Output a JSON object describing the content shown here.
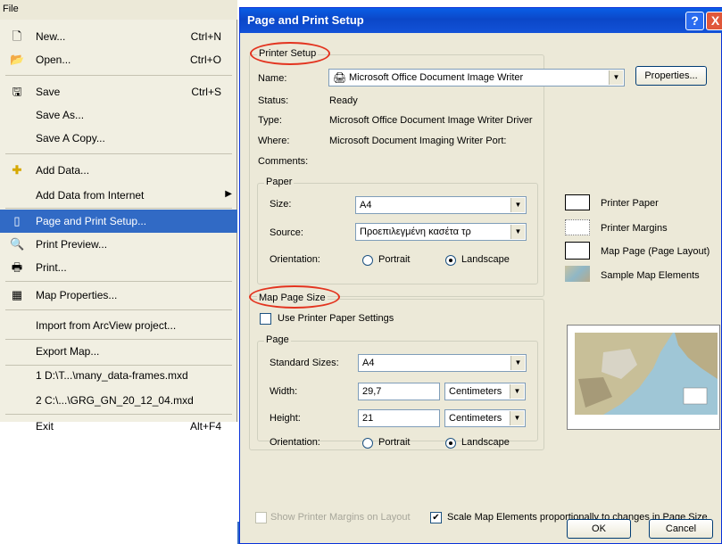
{
  "menu": {
    "bar_label": "File",
    "items": [
      {
        "icon": "new-icon",
        "label": "New...",
        "shortcut": "Ctrl+N"
      },
      {
        "icon": "open-icon",
        "label": "Open...",
        "shortcut": "Ctrl+O"
      },
      {
        "icon": "save-icon",
        "label": "Save",
        "shortcut": "Ctrl+S"
      },
      {
        "icon": "",
        "label": "Save As...",
        "shortcut": ""
      },
      {
        "icon": "",
        "label": "Save A Copy...",
        "shortcut": ""
      },
      {
        "icon": "add-data-icon",
        "label": "Add Data...",
        "shortcut": ""
      },
      {
        "icon": "",
        "label": "Add Data from Internet",
        "shortcut": ""
      },
      {
        "icon": "page-setup-icon",
        "label": "Page and Print Setup...",
        "shortcut": ""
      },
      {
        "icon": "print-preview-icon",
        "label": "Print Preview...",
        "shortcut": ""
      },
      {
        "icon": "print-icon",
        "label": "Print...",
        "shortcut": ""
      },
      {
        "icon": "map-properties-icon",
        "label": "Map Properties...",
        "shortcut": ""
      },
      {
        "icon": "",
        "label": "Import from ArcView project...",
        "shortcut": ""
      },
      {
        "icon": "",
        "label": "Export Map...",
        "shortcut": ""
      },
      {
        "icon": "",
        "label": "1 D:\\T...\\many_data-frames.mxd",
        "shortcut": ""
      },
      {
        "icon": "",
        "label": "2 C:\\...\\GRG_GN_20_12_04.mxd",
        "shortcut": ""
      },
      {
        "icon": "",
        "label": "Exit",
        "shortcut": "Alt+F4"
      }
    ]
  },
  "dialog": {
    "title": "Page and Print Setup",
    "help_glyph": "?",
    "close_glyph": "X",
    "printer_setup": {
      "group_title": "Printer Setup",
      "name_label": "Name:",
      "name_value": "Microsoft Office Document Image Writer",
      "properties_button": "Properties...",
      "status_label": "Status:",
      "status_value": "Ready",
      "type_label": "Type:",
      "type_value": "Microsoft Office Document Image Writer Driver",
      "where_label": "Where:",
      "where_value": "Microsoft Document Imaging Writer Port:",
      "comments_label": "Comments:",
      "comments_value": "",
      "paper": {
        "group_title": "Paper",
        "size_label": "Size:",
        "size_value": "A4",
        "source_label": "Source:",
        "source_value": "Προεπιλεγμένη κασέτα τρ",
        "orientation_label": "Orientation:",
        "portrait_label": "Portrait",
        "landscape_label": "Landscape",
        "selected": "Landscape"
      }
    },
    "legend": {
      "printer_paper": "Printer Paper",
      "printer_margins": "Printer Margins",
      "map_page": "Map Page (Page Layout)",
      "sample_elements": "Sample Map Elements"
    },
    "map_page_size": {
      "group_title": "Map Page Size",
      "use_printer_paper": "Use Printer Paper Settings",
      "use_printer_paper_checked": false,
      "page_group_title": "Page",
      "standard_sizes_label": "Standard Sizes:",
      "standard_sizes_value": "A4",
      "width_label": "Width:",
      "width_value": "29,7",
      "width_unit": "Centimeters",
      "height_label": "Height:",
      "height_value": "21",
      "height_unit": "Centimeters",
      "orientation_label": "Orientation:",
      "portrait_label": "Portrait",
      "landscape_label": "Landscape",
      "selected": "Landscape"
    },
    "show_margins": "Show Printer Margins on Layout",
    "show_margins_checked": false,
    "scale_elements": "Scale Map Elements proportionally to changes in Page Size",
    "scale_elements_checked": true,
    "ok_button": "OK",
    "cancel_button": "Cancel"
  },
  "colors": {
    "highlight": "#316ac5",
    "annotation": "#e3341f",
    "titlebar": "#0a5fe6"
  }
}
